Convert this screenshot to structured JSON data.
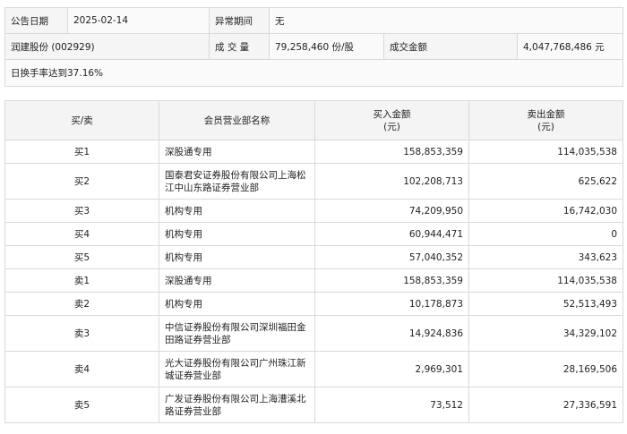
{
  "info": {
    "date_label": "公告日期",
    "date_value": "2025-02-14",
    "abnormal_label": "异常期间",
    "abnormal_value": "无",
    "stock_name": "润建股份 (002929)",
    "volume_label": "成 交 量",
    "volume_value": "79,258,460 份/股",
    "amount_label": "成交金额",
    "amount_value": "4,047,768,486 元",
    "reason": "日换手率达到37.16%"
  },
  "table": {
    "headers": {
      "side": "买/卖",
      "branch": "会员营业部名称",
      "buy": "买入金额",
      "buy_unit": "(元)",
      "sell": "卖出金额",
      "sell_unit": "(元)"
    },
    "rows": [
      {
        "side": "买1",
        "branch": "深股通专用",
        "buy": "158,853,359",
        "sell": "114,035,538"
      },
      {
        "side": "买2",
        "branch": "国泰君安证券股份有限公司上海松江中山东路证券营业部",
        "buy": "102,208,713",
        "sell": "625,622"
      },
      {
        "side": "买3",
        "branch": "机构专用",
        "buy": "74,209,950",
        "sell": "16,742,030"
      },
      {
        "side": "买4",
        "branch": "机构专用",
        "buy": "60,944,471",
        "sell": "0"
      },
      {
        "side": "买5",
        "branch": "机构专用",
        "buy": "57,040,352",
        "sell": "343,623"
      },
      {
        "side": "卖1",
        "branch": "深股通专用",
        "buy": "158,853,359",
        "sell": "114,035,538"
      },
      {
        "side": "卖2",
        "branch": "机构专用",
        "buy": "10,178,873",
        "sell": "52,513,493"
      },
      {
        "side": "卖3",
        "branch": "中信证券股份有限公司深圳福田金田路证券营业部",
        "buy": "14,924,836",
        "sell": "34,329,102"
      },
      {
        "side": "卖4",
        "branch": "光大证券股份有限公司广州珠江新城证券营业部",
        "buy": "2,969,301",
        "sell": "28,169,506"
      },
      {
        "side": "卖5",
        "branch": "广发证券股份有限公司上海漕溪北路证券营业部",
        "buy": "73,512",
        "sell": "27,336,591"
      }
    ]
  }
}
